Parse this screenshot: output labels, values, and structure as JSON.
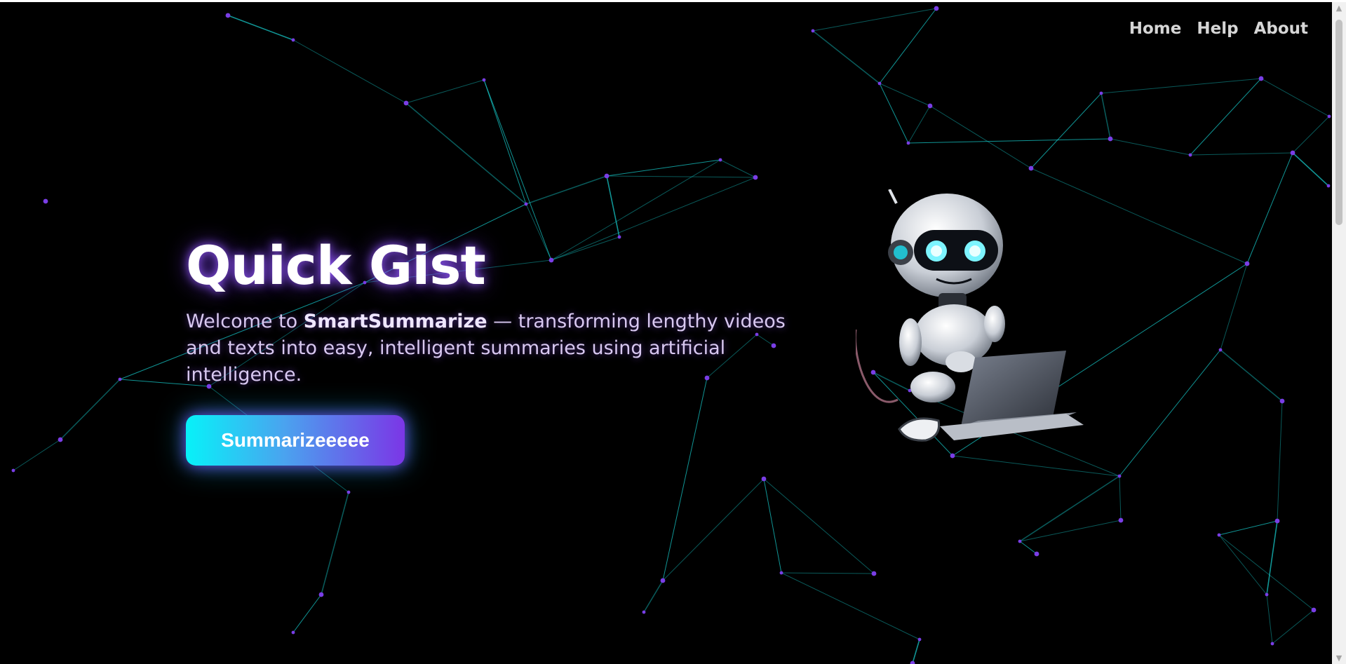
{
  "nav": {
    "items": [
      "Home",
      "Help",
      "About"
    ]
  },
  "hero": {
    "title": "Quick Gist",
    "tagline_prefix": "Welcome to ",
    "brand": "SmartSummarize",
    "tagline_suffix": " — transforming lengthy videos and texts into easy, intelligent summaries using artificial intelligence.",
    "cta_label": "Summarizeeeee"
  },
  "colors": {
    "background": "#000000",
    "network_line": "#16c6c6",
    "network_node": "#7a3ee6",
    "button_start": "#07f2f9",
    "button_end": "#7b36e6"
  },
  "icons": {
    "hero_illustration": "robot-with-laptop"
  }
}
